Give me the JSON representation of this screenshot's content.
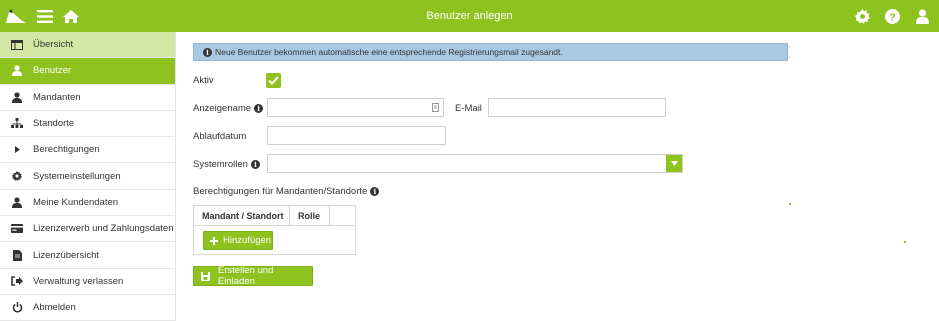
{
  "header": {
    "title": "Benutzer anlegen",
    "icons": [
      "logo-icon",
      "menu-icon",
      "home-icon",
      "gear-icon",
      "help-icon",
      "user-icon"
    ]
  },
  "sidebar": {
    "items": [
      {
        "label": "Übersicht",
        "icon": "table-icon",
        "state": "highlight"
      },
      {
        "label": "Benutzer",
        "icon": "user-icon",
        "state": "active"
      },
      {
        "label": "Mandanten",
        "icon": "users-icon",
        "state": ""
      },
      {
        "label": "Standorte",
        "icon": "sitemap-icon",
        "state": ""
      },
      {
        "label": "Berechtigungen",
        "icon": "caret-right-icon",
        "state": ""
      },
      {
        "label": "Systemeinstellungen",
        "icon": "gear-icon",
        "state": ""
      },
      {
        "label": "Meine Kundendaten",
        "icon": "users-icon",
        "state": ""
      },
      {
        "label": "Lizenzerwerb und Zahlungsdaten",
        "icon": "credit-card-icon",
        "state": ""
      },
      {
        "label": "Lizenzübersicht",
        "icon": "document-icon",
        "state": ""
      },
      {
        "label": "Verwaltung verlassen",
        "icon": "sign-out-icon",
        "state": ""
      },
      {
        "label": "Abmelden",
        "icon": "power-icon",
        "state": ""
      }
    ]
  },
  "form": {
    "info_text": "Neue Benutzer bekommen automatische eine entsprechende Registrierungsmail zugesandt.",
    "aktiv_label": "Aktiv",
    "aktiv_checked": true,
    "anzeigename_label": "Anzeigename",
    "anzeigename_value": "",
    "email_label": "E-Mail",
    "email_value": "",
    "ablaufdatum_label": "Ablaufdatum",
    "ablaufdatum_value": "",
    "systemrollen_label": "Systemrollen",
    "systemrollen_value": "",
    "permissions_label": "Berechtigungen für Mandanten/Standorte",
    "table_headers": [
      "Mandant / Standort",
      "Rolle"
    ],
    "add_button": "Hinzufügen",
    "submit_button": "Erstellen und Einladen"
  },
  "colors": {
    "accent": "#8dc21f",
    "highlight": "#d4e8a6",
    "info_bg": "#a9c9e3"
  }
}
